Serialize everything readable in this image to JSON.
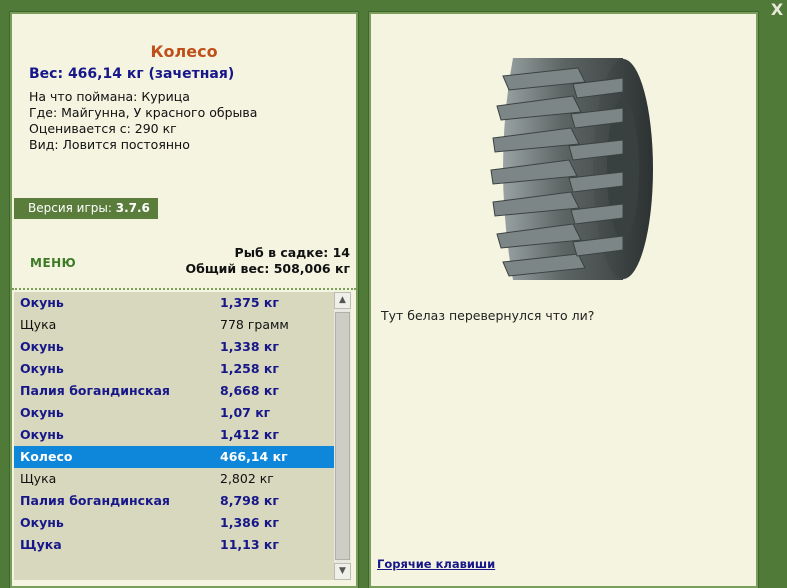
{
  "close_label": "X",
  "info": {
    "title": "Колесо",
    "weight": "Вес: 466,14 кг (зачетная)",
    "caught_on": "На что поймана: Курица",
    "location": "Где: Майгунна, У красного обрыва",
    "price": "Оценивается с: 290 кг",
    "kind": "Вид: Ловится постоянно"
  },
  "version": {
    "label": "Версия игры:",
    "value": "3.7.6"
  },
  "menu_label": "Меню",
  "stats": {
    "fish_count": "Рыб в садке: 14",
    "total_weight": "Общий вес: 508,006 кг"
  },
  "catch_list": [
    {
      "name": "Окунь",
      "weight": "1,375 кг",
      "style": "bold"
    },
    {
      "name": "Щука",
      "weight": "778 грамм",
      "style": "normal"
    },
    {
      "name": "Окунь",
      "weight": "1,338 кг",
      "style": "bold"
    },
    {
      "name": "Окунь",
      "weight": "1,258 кг",
      "style": "bold"
    },
    {
      "name": "Палия богандинская",
      "weight": "8,668 кг",
      "style": "bold"
    },
    {
      "name": "Окунь",
      "weight": "1,07 кг",
      "style": "bold"
    },
    {
      "name": "Окунь",
      "weight": "1,412 кг",
      "style": "bold"
    },
    {
      "name": "Колесо",
      "weight": "466,14 кг",
      "style": "selected"
    },
    {
      "name": "Щука",
      "weight": "2,802 кг",
      "style": "normal"
    },
    {
      "name": "Палия богандинская",
      "weight": "8,798 кг",
      "style": "bold"
    },
    {
      "name": "Окунь",
      "weight": "1,386 кг",
      "style": "bold"
    },
    {
      "name": "Щука",
      "weight": "11,13 кг",
      "style": "bold"
    }
  ],
  "comment": "Тут белаз перевернулся что ли?",
  "hotkeys_label": "Горячие клавиши",
  "colors": {
    "background": "#4f7a37",
    "panel": "#f4f4e1",
    "accent_title": "#c0501a",
    "accent_text": "#17178a",
    "selection": "#0e86da"
  }
}
